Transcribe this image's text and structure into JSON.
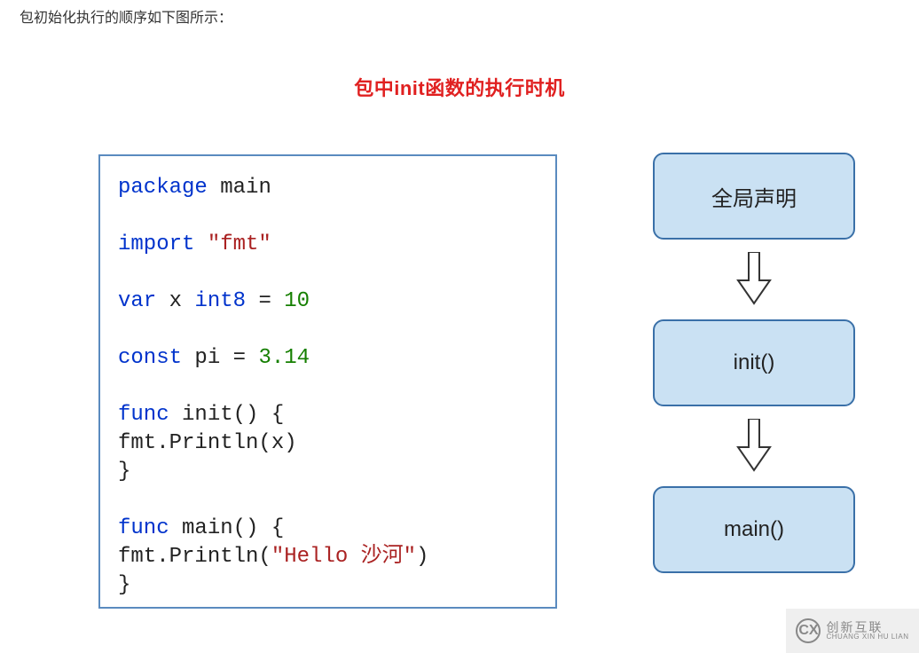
{
  "intro_text": "包初始化执行的顺序如下图所示：",
  "title": "包中init函数的执行时机",
  "code": {
    "line1_kw_package": "package",
    "line1_main": " main",
    "blank": "",
    "line2_kw_import": "import",
    "line2_str": " \"fmt\"",
    "line3_kw_var": "var",
    "line3_mid": " x ",
    "line3_type": "int8",
    "line3_eq": " = ",
    "line3_num": "10",
    "line4_kw_const": "const",
    "line4_mid": " pi = ",
    "line4_num": "3.14",
    "line5_kw_func": "func",
    "line5_init": " init() {",
    "line6_indent": "    fmt.Println(x)",
    "line7": "}",
    "line8_kw_func": "func",
    "line8_main": " main() {",
    "line9_pre": "    fmt.Println(",
    "line9_str": "\"Hello 沙河\"",
    "line9_post": ")",
    "line10": "}"
  },
  "flow": {
    "step1": "全局声明",
    "step2": "init()",
    "step3": "main()"
  },
  "watermark": {
    "zh": "创新互联",
    "py": "CHUANG XIN HU LIAN",
    "icon_letters": "CX"
  }
}
